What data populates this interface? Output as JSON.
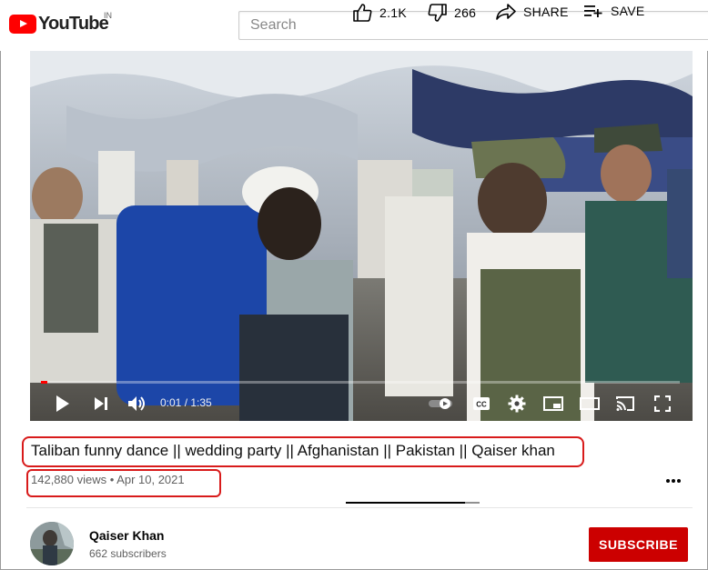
{
  "header": {
    "logo_text": "YouTube",
    "country_code": "IN",
    "search_placeholder": "Search"
  },
  "player": {
    "time_current": "0:01",
    "time_total": "1:35",
    "time_display": "0:01 / 1:35",
    "progress_fraction": 0.01
  },
  "video": {
    "title": "Taliban funny dance || wedding party || Afghanistan || Pakistan || Qaiser khan",
    "views": "142,880 views",
    "separator": "•",
    "date": "Apr 10, 2021",
    "meta_line": "142,880 views • Apr 10, 2021",
    "likes": "2.1K",
    "dislikes": "266",
    "share_label": "SHARE",
    "save_label": "SAVE",
    "like_fraction": 0.89
  },
  "channel": {
    "name": "Qaiser Khan",
    "subscribers": "662 subscribers",
    "subscribe_label": "SUBSCRIBE"
  },
  "colors": {
    "brand_red": "#ff0000",
    "subscribe_red": "#cc0000",
    "annotation_red": "#d81b1b"
  },
  "icons": [
    "youtube-logo-icon",
    "play-icon",
    "next-icon",
    "volume-icon",
    "autoplay-toggle-icon",
    "captions-icon",
    "settings-icon",
    "miniplayer-icon",
    "theater-icon",
    "cast-icon",
    "fullscreen-icon",
    "thumbs-up-icon",
    "thumbs-down-icon",
    "share-icon",
    "save-playlist-icon",
    "more-icon"
  ]
}
